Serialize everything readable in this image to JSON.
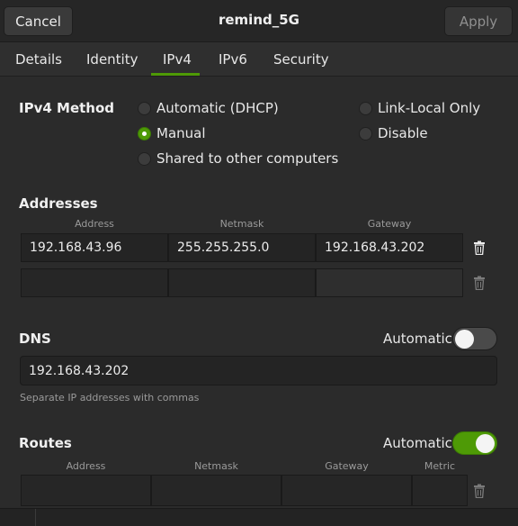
{
  "window": {
    "title": "remind_5G"
  },
  "header": {
    "cancel_label": "Cancel",
    "apply_label": "Apply"
  },
  "tabs": [
    {
      "label": "Details"
    },
    {
      "label": "Identity"
    },
    {
      "label": "IPv4",
      "active": true
    },
    {
      "label": "IPv6"
    },
    {
      "label": "Security"
    }
  ],
  "ipv4_method": {
    "label": "IPv4 Method",
    "selected": "Manual",
    "options": {
      "automatic": "Automatic (DHCP)",
      "manual": "Manual",
      "shared": "Shared to other computers",
      "link_local": "Link-Local Only",
      "disable": "Disable"
    }
  },
  "addresses": {
    "label": "Addresses",
    "headers": {
      "address": "Address",
      "netmask": "Netmask",
      "gateway": "Gateway"
    },
    "rows": [
      {
        "address": "192.168.43.96",
        "netmask": "255.255.255.0",
        "gateway": "192.168.43.202"
      },
      {
        "address": "",
        "netmask": "",
        "gateway": ""
      }
    ]
  },
  "dns": {
    "label": "DNS",
    "automatic_label": "Automatic",
    "automatic_on": false,
    "value": "192.168.43.202",
    "hint": "Separate IP addresses with commas"
  },
  "routes": {
    "label": "Routes",
    "automatic_label": "Automatic",
    "automatic_on": true,
    "headers": {
      "address": "Address",
      "netmask": "Netmask",
      "gateway": "Gateway",
      "metric": "Metric"
    }
  },
  "colors": {
    "accent": "#4e9a06",
    "background": "#2b2b2b",
    "field": "#242424"
  }
}
